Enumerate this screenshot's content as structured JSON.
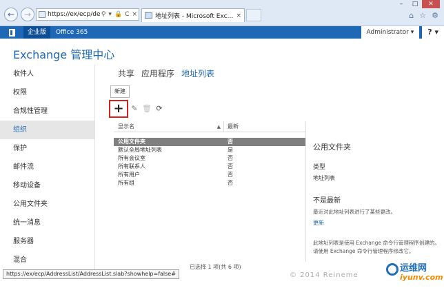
{
  "browser": {
    "url": "https://ex/ecp/default.a",
    "tab_title": "地址列表 - Microsoft Exc...",
    "tab_close": "×",
    "addr_controls": [
      "⚲",
      "▾",
      "🔒",
      "C",
      "×"
    ]
  },
  "topbar": {
    "enterprise": "企业版",
    "office365": "Office 365",
    "user": "Administrator ▾",
    "help": "? ▾"
  },
  "app": {
    "title": "Exchange 管理中心"
  },
  "leftnav": {
    "items": [
      {
        "label": "收件人"
      },
      {
        "label": "权限"
      },
      {
        "label": "合规性管理"
      },
      {
        "label": "组织"
      },
      {
        "label": "保护"
      },
      {
        "label": "邮件流"
      },
      {
        "label": "移动设备"
      },
      {
        "label": "公用文件夹"
      },
      {
        "label": "统一消息"
      },
      {
        "label": "服务器"
      },
      {
        "label": "混合"
      }
    ],
    "selected_index": 3
  },
  "subtabs": {
    "items": [
      {
        "label": "共享"
      },
      {
        "label": "应用程序"
      },
      {
        "label": "地址列表"
      }
    ],
    "active_index": 2
  },
  "toolbar": {
    "new_tooltip": "新建",
    "add_label": "+"
  },
  "grid": {
    "col_name": "显示名",
    "col_latest": "最新",
    "rows": [
      {
        "name": "公用文件夹",
        "latest": "否"
      },
      {
        "name": "默认全局地址列表",
        "latest": "是"
      },
      {
        "name": "所有会议室",
        "latest": "否"
      },
      {
        "name": "所有联系人",
        "latest": "否"
      },
      {
        "name": "所有用户",
        "latest": "否"
      },
      {
        "name": "所有组",
        "latest": "否"
      }
    ],
    "selected_index": 0,
    "footer": "已选择 1 项(共 6 项)"
  },
  "details": {
    "title": "公用文件夹",
    "type_label": "类型",
    "type_value": "地址列表",
    "status_head": "不是最新",
    "status_text": "最近对此地址列表进行了某些更改。",
    "update_link": "更新",
    "note": "此地址列表是使用 Exchange 命令行管理程序创建的。请使用 Exchange 命令行管理程序修改它。"
  },
  "status": {
    "link_url": "https://ex/ecp/AddressList/AddressList.slab?showhelp=false#"
  },
  "watermark": {
    "copyright": "© 2014 Reineme",
    "site_cn": "运维网",
    "site_en": "iyunv.com"
  },
  "colors": {
    "accent": "#1f68b5",
    "highlight_border": "#d42020",
    "selected_row": "#7f7f7f"
  }
}
